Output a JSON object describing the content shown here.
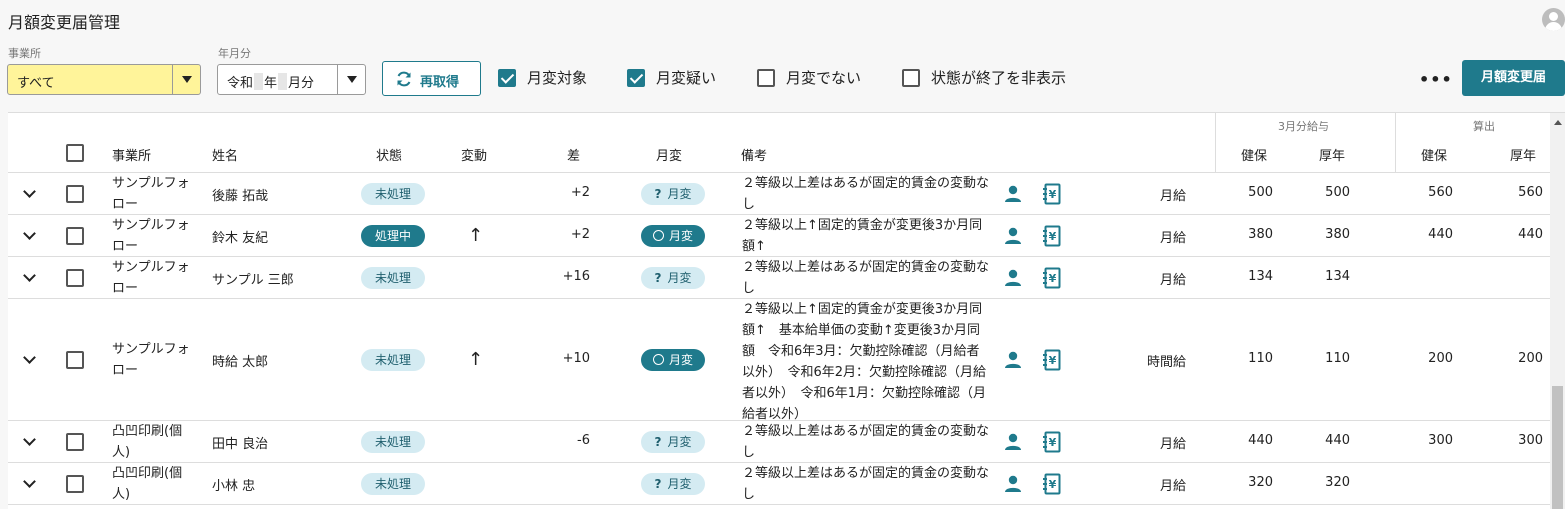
{
  "header": {
    "title": "月額変更届管理"
  },
  "filters": {
    "office_label": "事業所",
    "office_value": "すべて",
    "ym_label": "年月分",
    "ym_parts": [
      "令和",
      "年",
      "月分"
    ],
    "reload_label": "再取得",
    "checks": [
      {
        "label": "月変対象",
        "checked": true
      },
      {
        "label": "月変疑い",
        "checked": true
      },
      {
        "label": "月変でない",
        "checked": false
      },
      {
        "label": "状態が終了を非表示",
        "checked": false
      }
    ],
    "more_label": "•••",
    "primary_label": "月額変更届"
  },
  "table": {
    "group_headers": {
      "wage": "3月分給与",
      "calc": "算出"
    },
    "columns": {
      "office": "事業所",
      "name": "姓名",
      "status": "状態",
      "change": "変動",
      "diff": "差",
      "getsuhen": "月変",
      "note": "備考",
      "kenpo": "健保",
      "kounen": "厚年",
      "kenpo2": "健保",
      "kounen2": "厚年"
    },
    "rows": [
      {
        "office": "サンプルフォロー",
        "name": "後藤 拓哉",
        "status": "未処理",
        "status_dark": false,
        "change": "",
        "diff": "+2",
        "getsuhen": "月変",
        "getsuhen_type": "question",
        "note": "２等級以上差はあるが固定的賃金の変動なし",
        "pay_type": "月給",
        "kenpo": "500",
        "kounen": "500",
        "kenpo2": "560",
        "kounen2": "560"
      },
      {
        "office": "サンプルフォロー",
        "name": "鈴木 友紀",
        "status": "処理中",
        "status_dark": true,
        "change": "↑",
        "diff": "+2",
        "getsuhen": "月変",
        "getsuhen_type": "confirmed",
        "note": "２等級以上↑固定的賃金が変更後3か月同額↑",
        "pay_type": "月給",
        "kenpo": "380",
        "kounen": "380",
        "kenpo2": "440",
        "kounen2": "440"
      },
      {
        "office": "サンプルフォロー",
        "name": "サンプル 三郎",
        "status": "未処理",
        "status_dark": false,
        "change": "",
        "diff": "+16",
        "getsuhen": "月変",
        "getsuhen_type": "question",
        "note": "２等級以上差はあるが固定的賃金の変動なし",
        "pay_type": "月給",
        "kenpo": "134",
        "kounen": "134",
        "kenpo2": "",
        "kounen2": ""
      },
      {
        "office": "サンプルフォロー",
        "name": "時給 太郎",
        "status": "未処理",
        "status_dark": false,
        "change": "↑",
        "diff": "+10",
        "getsuhen": "月変",
        "getsuhen_type": "confirmed",
        "note": "２等級以上↑固定的賃金が変更後3か月同額↑　基本給単価の変動↑変更後3か月同額　令和6年3月：欠勤控除確認（月給者以外）　令和6年2月：欠勤控除確認（月給者以外）　令和6年1月：欠勤控除確認（月給者以外）",
        "pay_type": "時間給",
        "kenpo": "110",
        "kounen": "110",
        "kenpo2": "200",
        "kounen2": "200"
      },
      {
        "office": "凸凹印刷(個人)",
        "name": "田中 良治",
        "status": "未処理",
        "status_dark": false,
        "change": "",
        "diff": "-6",
        "getsuhen": "月変",
        "getsuhen_type": "question",
        "note": "２等級以上差はあるが固定的賃金の変動なし",
        "pay_type": "月給",
        "kenpo": "440",
        "kounen": "440",
        "kenpo2": "300",
        "kounen2": "300"
      },
      {
        "office": "凸凹印刷(個人)",
        "name": "小林 忠",
        "status": "未処理",
        "status_dark": false,
        "change": "",
        "diff": "",
        "getsuhen": "月変",
        "getsuhen_type": "question",
        "note": "２等級以上差はあるが固定的賃金の変動なし",
        "pay_type": "月給",
        "kenpo": "320",
        "kounen": "320",
        "kenpo2": "",
        "kounen2": ""
      }
    ]
  },
  "colors": {
    "accent": "#1f7a8c",
    "badge_light": "#d4ebf2",
    "highlight": "#fff49a"
  }
}
